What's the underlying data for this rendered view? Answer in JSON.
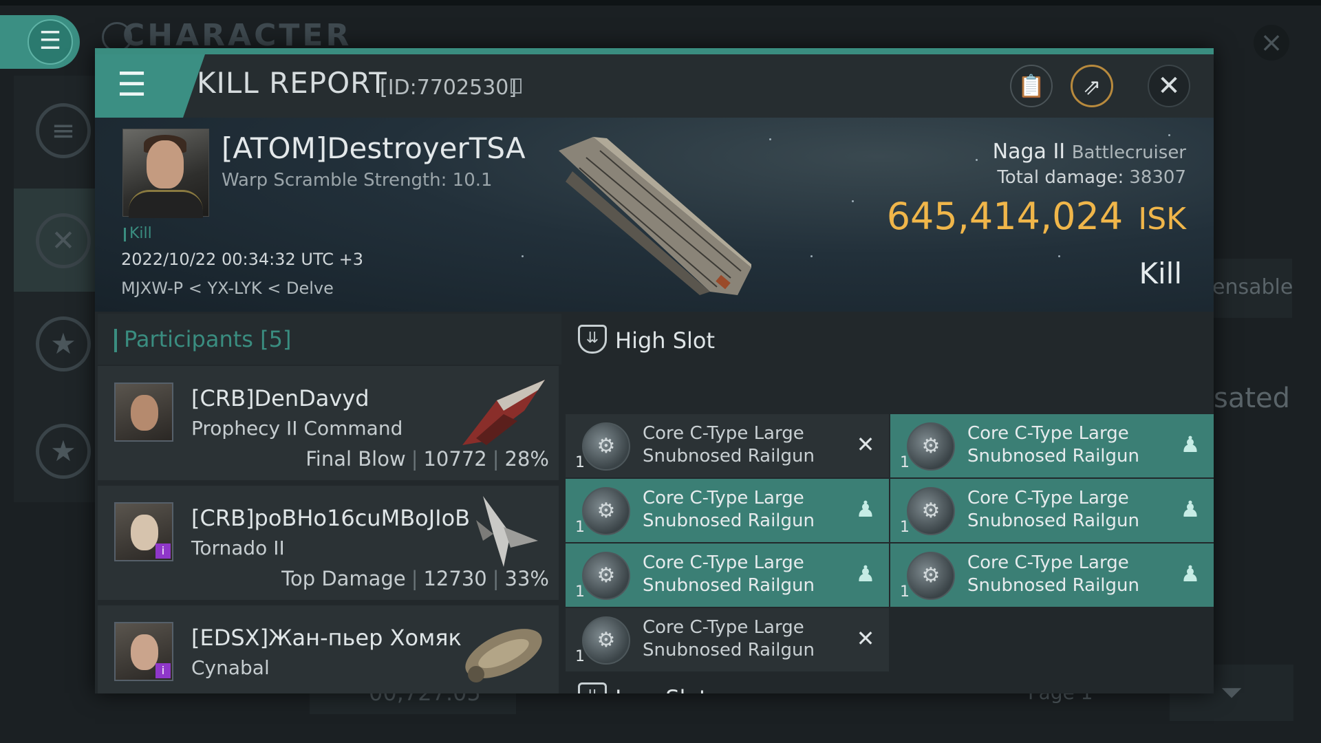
{
  "background": {
    "title": "CHARACTER",
    "right_text_1": "ensable",
    "right_text_2": "sated",
    "bottom_value": "00,727.05",
    "page_label": "Page 1"
  },
  "dialog": {
    "title": "KILL REPORT",
    "report_id": "[ID:7702530]",
    "toolbar": {
      "menu_icon": "menu-icon",
      "clipboard_icon": "clipboard-icon",
      "share_icon": "share-icon",
      "close_icon": "close-icon"
    }
  },
  "victim": {
    "name": "[ATOM]DestroyerTSA",
    "warp_scramble": "Warp Scramble Strength: 10.1",
    "tag": "Kill",
    "datetime": "2022/10/22 00:34:32 UTC +3",
    "location": "MJXW-P < YX-LYK < Delve",
    "ship_name": "Naga II",
    "ship_class": "Battlecruiser",
    "total_damage_label": "Total damage:",
    "total_damage": "38307",
    "isk_value": "645,414,024",
    "isk_unit": "ISK",
    "result": "Kill"
  },
  "participants": {
    "header": "Participants [5]",
    "items": [
      {
        "name": "[CRB]DenDavyd",
        "ship": "Prophecy II Command",
        "role": "Final Blow",
        "damage": "10772",
        "percent": "28%"
      },
      {
        "name": "[CRB]poBHo16cuMBoJIoB",
        "ship": "Tornado II",
        "role": "Top Damage",
        "damage": "12730",
        "percent": "33%"
      },
      {
        "name": "[EDSX]Жан-пьер Хомяк",
        "ship": "Cynabal",
        "role": "",
        "damage": "",
        "percent": ""
      }
    ]
  },
  "fitting": {
    "high_slot_label": "High Slot",
    "low_slot_label": "Low Slot",
    "high_slot_modules": [
      {
        "qty": "1",
        "name": "Core C-Type Large Snubnosed Railgun",
        "status": "destroyed"
      },
      {
        "qty": "1",
        "name": "Core C-Type Large Snubnosed Railgun",
        "status": "dropped"
      },
      {
        "qty": "1",
        "name": "Core C-Type Large Snubnosed Railgun",
        "status": "dropped"
      },
      {
        "qty": "1",
        "name": "Core C-Type Large Snubnosed Railgun",
        "status": "dropped"
      },
      {
        "qty": "1",
        "name": "Core C-Type Large Snubnosed Railgun",
        "status": "dropped"
      },
      {
        "qty": "1",
        "name": "Core C-Type Large Snubnosed Railgun",
        "status": "dropped"
      },
      {
        "qty": "1",
        "name": "Core C-Type Large Snubnosed Railgun",
        "status": "destroyed"
      }
    ]
  },
  "colors": {
    "accent": "#3a8d80",
    "isk": "#f0b64a",
    "dropped_bg": "#3b7f75",
    "destroyed_bg": "#2b3235",
    "omega_badge": "#8f37c9"
  }
}
